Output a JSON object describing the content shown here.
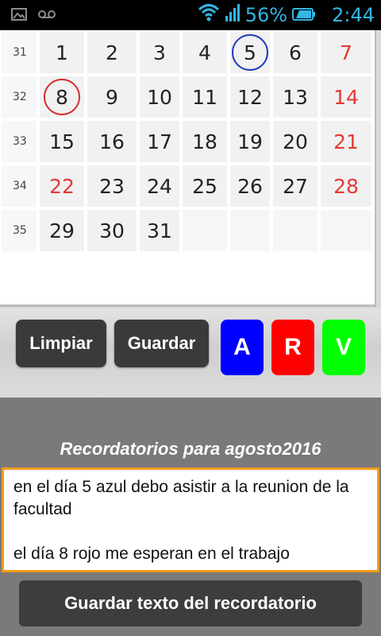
{
  "status_bar": {
    "icons_left": [
      "image-icon",
      "voicemail-icon"
    ],
    "icons_right": [
      "wifi-icon",
      "signal-icon",
      "battery-icon"
    ],
    "battery_percent": "56%",
    "time": "2:44",
    "accent_color": "#33b5e5"
  },
  "calendar": {
    "weeks": [
      {
        "week": "31",
        "days": [
          "1",
          "2",
          "3",
          "4",
          "5",
          "6",
          "7"
        ]
      },
      {
        "week": "32",
        "days": [
          "8",
          "9",
          "10",
          "11",
          "12",
          "13",
          "14"
        ]
      },
      {
        "week": "33",
        "days": [
          "15",
          "16",
          "17",
          "18",
          "19",
          "20",
          "21"
        ]
      },
      {
        "week": "34",
        "days": [
          "22",
          "23",
          "24",
          "25",
          "26",
          "27",
          "28"
        ]
      },
      {
        "week": "35",
        "days": [
          "29",
          "30",
          "31",
          "",
          "",
          "",
          ""
        ]
      }
    ],
    "red_days": [
      "7",
      "14",
      "21",
      "22",
      "28"
    ],
    "circled": [
      {
        "day": "5",
        "color": "#1f3fbf"
      },
      {
        "day": "8",
        "color": "#d32f2f"
      }
    ]
  },
  "buttons": {
    "clear_label": "Limpiar",
    "save_label": "Guardar",
    "color_a": {
      "label": "A",
      "color": "#0000ff"
    },
    "color_r": {
      "label": "R",
      "color": "#ff0000"
    },
    "color_v": {
      "label": "V",
      "color": "#00ff00"
    }
  },
  "reminders": {
    "title": "Recordatorios para  agosto2016",
    "text": "en el día 5 azul debo asistir a la reunion de la facultad\n\nel día 8 rojo me esperan en el trabajo",
    "save_button_label": "Guardar texto del recordatorio",
    "border_color": "#f39c1a"
  }
}
